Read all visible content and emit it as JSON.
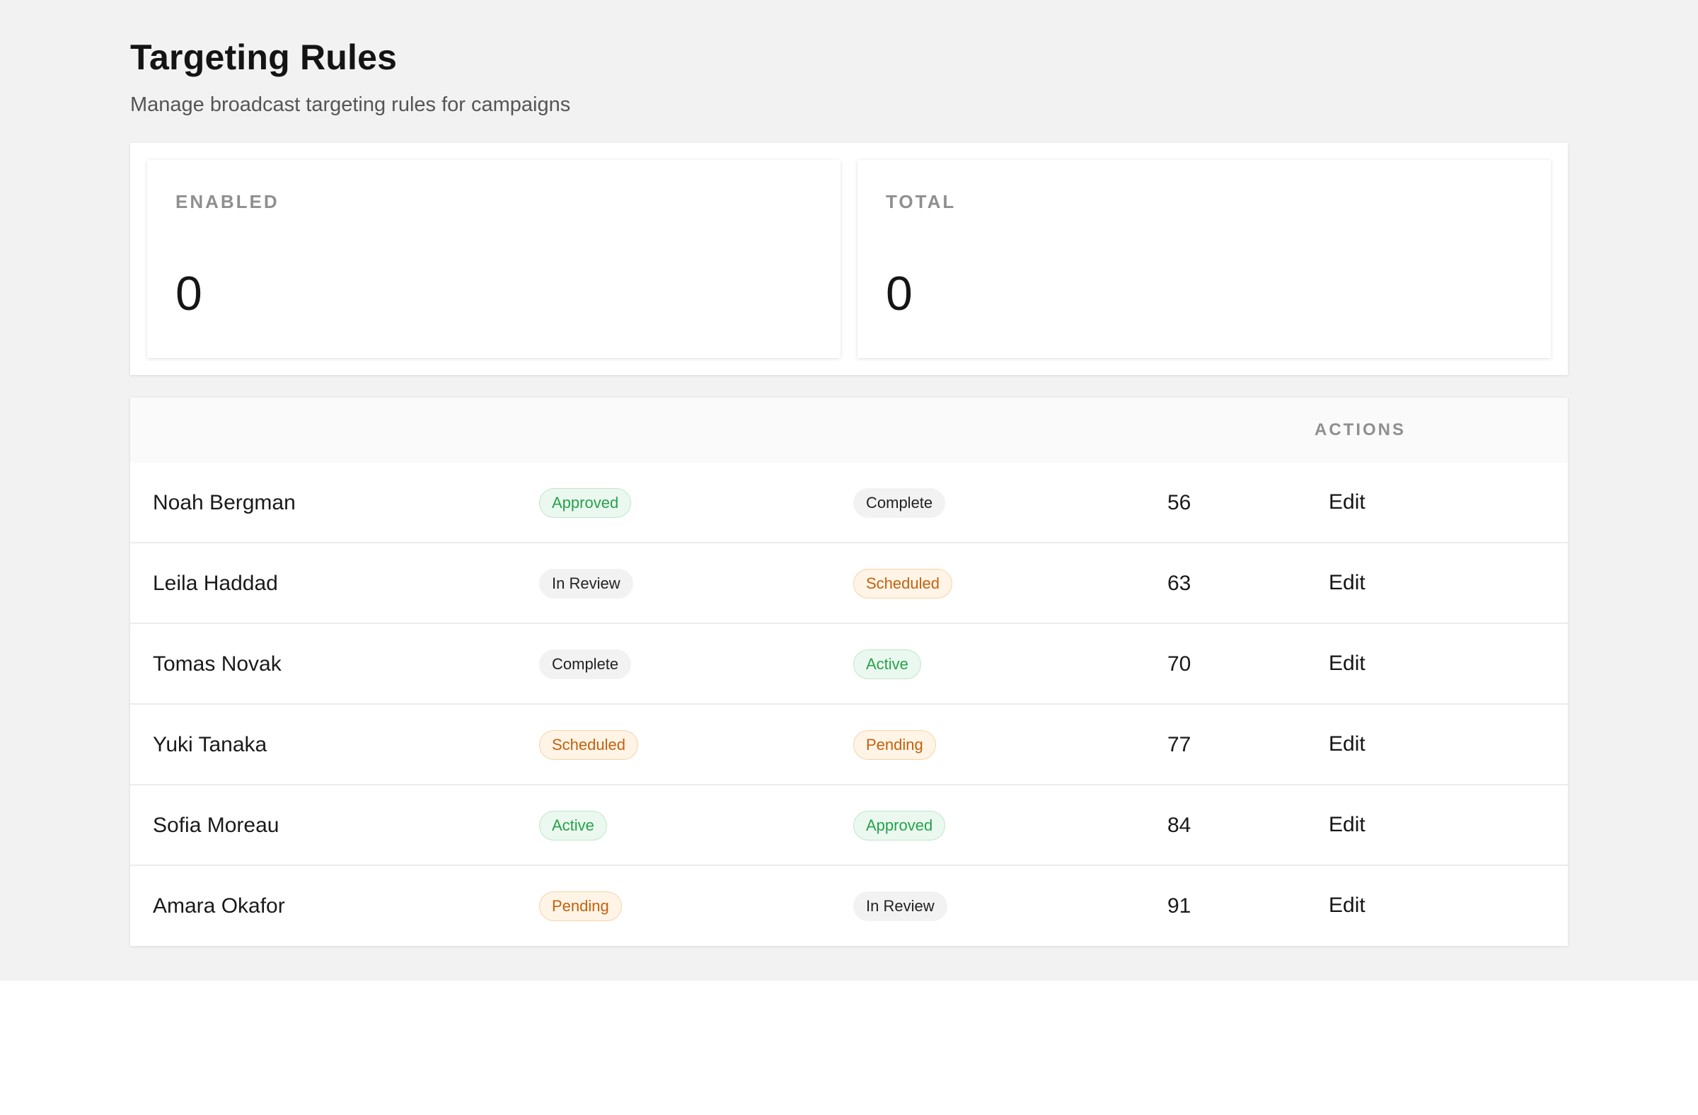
{
  "page": {
    "title": "Targeting Rules",
    "subtitle": "Manage broadcast targeting rules for campaigns"
  },
  "stats": [
    {
      "label": "ENABLED",
      "value": "0"
    },
    {
      "label": "TOTAL",
      "value": "0"
    }
  ],
  "table": {
    "headers": {
      "actions": "ACTIONS"
    },
    "rows": [
      {
        "name": "Noah Bergman",
        "status1": "Approved",
        "status2": "Complete",
        "value": "56",
        "action": "Edit"
      },
      {
        "name": "Leila Haddad",
        "status1": "In Review",
        "status2": "Scheduled",
        "value": "63",
        "action": "Edit"
      },
      {
        "name": "Tomas Novak",
        "status1": "Complete",
        "status2": "Active",
        "value": "70",
        "action": "Edit"
      },
      {
        "name": "Yuki Tanaka",
        "status1": "Scheduled",
        "status2": "Pending",
        "value": "77",
        "action": "Edit"
      },
      {
        "name": "Sofia Moreau",
        "status1": "Active",
        "status2": "Approved",
        "value": "84",
        "action": "Edit"
      },
      {
        "name": "Amara Okafor",
        "status1": "Pending",
        "status2": "In Review",
        "value": "91",
        "action": "Edit"
      }
    ]
  },
  "status_colors": {
    "Approved": "#25a24b",
    "Active": "#25a24b",
    "Scheduled": "#c4610e",
    "Pending": "#c4610e",
    "Complete": "#222222",
    "In Review": "#222222"
  }
}
